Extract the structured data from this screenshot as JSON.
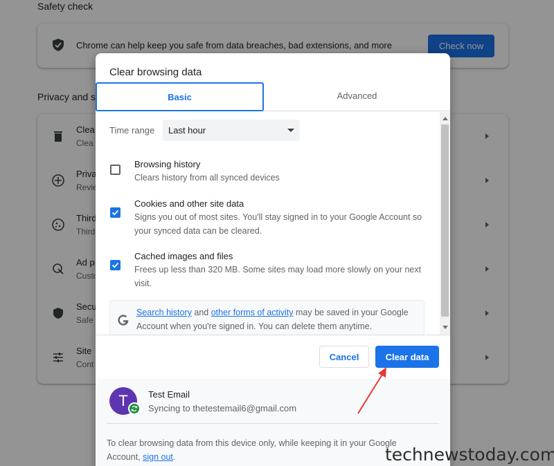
{
  "background": {
    "safety_check_title": "Safety check",
    "safety_text": "Chrome can help keep you safe from data breaches, bad extensions, and more",
    "check_now_label": "Check now",
    "privacy_title": "Privacy and s",
    "rows": [
      {
        "icon": "trash-icon",
        "t1": "Clea",
        "t2": "Clea"
      },
      {
        "icon": "privacy-guide-icon",
        "t1": "Priva",
        "t2": "Revie"
      },
      {
        "icon": "cookie-icon",
        "t1": "Third",
        "t2": "Third"
      },
      {
        "icon": "ad-privacy-icon",
        "t1": "Ad p",
        "t2": "Custo"
      },
      {
        "icon": "security-shield-icon",
        "t1": "Secu",
        "t2": "Safe"
      },
      {
        "icon": "tune-icon",
        "t1": "Site",
        "t2": "Cont"
      }
    ]
  },
  "dialog": {
    "title": "Clear browsing data",
    "tabs": {
      "basic": "Basic",
      "advanced": "Advanced"
    },
    "time_range": {
      "label": "Time range",
      "value": "Last hour"
    },
    "options": [
      {
        "title": "Browsing history",
        "desc": "Clears history from all synced devices",
        "checked": false
      },
      {
        "title": "Cookies and other site data",
        "desc": "Signs you out of most sites. You'll stay signed in to your Google Account so your synced data can be cleared.",
        "checked": true
      },
      {
        "title": "Cached images and files",
        "desc": "Frees up less than 320 MB. Some sites may load more slowly on your next visit.",
        "checked": true
      }
    ],
    "google_notice": {
      "link1": "Search history",
      "and": "and",
      "link2": "other forms of activity",
      "rest": "may be saved in your Google Account when you're signed in. You can delete them anytime."
    },
    "buttons": {
      "cancel": "Cancel",
      "clear": "Clear data"
    },
    "account": {
      "avatar_letter": "T",
      "name": "Test Email",
      "sync_text": "Syncing to thetestemail6@gmail.com"
    },
    "footer": {
      "text": "To clear browsing data from this device only, while keeping it in your Google Account,",
      "link": "sign out",
      "end": "."
    }
  },
  "colors": {
    "accent": "#1a73e8",
    "annotation_arrow": "#e53935",
    "avatar": "#5e35b1",
    "sync_badge": "#1e8e3e"
  },
  "watermark": "technewstoday.com"
}
